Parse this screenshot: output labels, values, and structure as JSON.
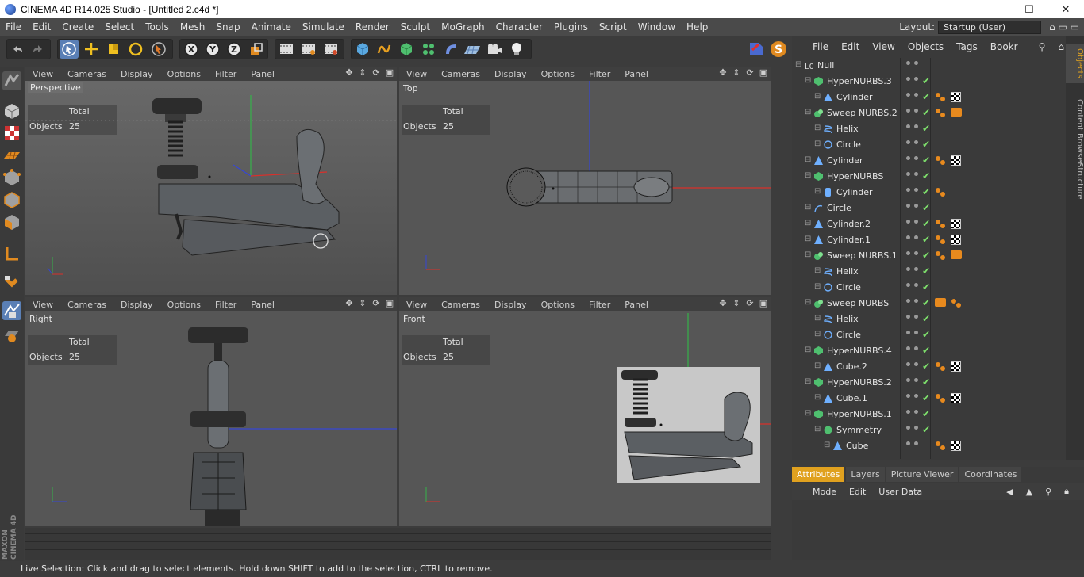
{
  "titlebar": {
    "title": "CINEMA 4D R14.025 Studio - [Untitled 2.c4d *]",
    "min": "—",
    "max": "☐",
    "close": "✕"
  },
  "menu": [
    "File",
    "Edit",
    "Create",
    "Select",
    "Tools",
    "Mesh",
    "Snap",
    "Animate",
    "Simulate",
    "Render",
    "Sculpt",
    "MoGraph",
    "Character",
    "Plugins",
    "Script",
    "Window",
    "Help"
  ],
  "layout": {
    "label": "Layout:",
    "value": "Startup (User)"
  },
  "viewport_menu": [
    "View",
    "Cameras",
    "Display",
    "Options",
    "Filter",
    "Panel"
  ],
  "viewports": [
    {
      "label": "Perspective",
      "hud_total": "Total",
      "hud_objects": "Objects",
      "hud_count": "25"
    },
    {
      "label": "Top",
      "hud_total": "Total",
      "hud_objects": "Objects",
      "hud_count": "25"
    },
    {
      "label": "Right",
      "hud_total": "Total",
      "hud_objects": "Objects",
      "hud_count": "25"
    },
    {
      "label": "Front",
      "hud_total": "Total",
      "hud_objects": "Objects",
      "hud_count": "25"
    }
  ],
  "objects_menu": [
    "File",
    "Edit",
    "View",
    "Objects",
    "Tags",
    "Bookr"
  ],
  "objects": [
    {
      "name": "Null",
      "indent": 0,
      "icon": "null",
      "check": false,
      "tags": []
    },
    {
      "name": "HyperNURBS.3",
      "indent": 1,
      "icon": "nurbs",
      "check": true,
      "tags": []
    },
    {
      "name": "Cylinder",
      "indent": 2,
      "icon": "prim",
      "check": true,
      "tags": [
        "orange",
        "checker"
      ]
    },
    {
      "name": "Sweep NURBS.2",
      "indent": 1,
      "icon": "sweep",
      "check": true,
      "tags": [
        "orange",
        "cam"
      ]
    },
    {
      "name": "Helix",
      "indent": 2,
      "icon": "helix",
      "check": true,
      "tags": []
    },
    {
      "name": "Circle",
      "indent": 2,
      "icon": "circle",
      "check": true,
      "tags": []
    },
    {
      "name": "Cylinder",
      "indent": 1,
      "icon": "prim",
      "check": true,
      "tags": [
        "orange",
        "checker"
      ]
    },
    {
      "name": "HyperNURBS",
      "indent": 1,
      "icon": "nurbs",
      "check": true,
      "tags": []
    },
    {
      "name": "Cylinder",
      "indent": 2,
      "icon": "cyl",
      "check": true,
      "tags": [
        "orange"
      ]
    },
    {
      "name": "Circle",
      "indent": 1,
      "icon": "spline",
      "check": true,
      "tags": []
    },
    {
      "name": "Cylinder.2",
      "indent": 1,
      "icon": "prim",
      "check": true,
      "tags": [
        "orange",
        "checker"
      ]
    },
    {
      "name": "Cylinder.1",
      "indent": 1,
      "icon": "prim",
      "check": true,
      "tags": [
        "orange",
        "checker"
      ]
    },
    {
      "name": "Sweep NURBS.1",
      "indent": 1,
      "icon": "sweep",
      "check": true,
      "tags": [
        "orange",
        "cam"
      ]
    },
    {
      "name": "Helix",
      "indent": 2,
      "icon": "helix",
      "check": true,
      "tags": []
    },
    {
      "name": "Circle",
      "indent": 2,
      "icon": "circle",
      "check": true,
      "tags": []
    },
    {
      "name": "Sweep NURBS",
      "indent": 1,
      "icon": "sweep",
      "check": true,
      "tags": [
        "cam",
        "orange"
      ]
    },
    {
      "name": "Helix",
      "indent": 2,
      "icon": "helix",
      "check": true,
      "tags": []
    },
    {
      "name": "Circle",
      "indent": 2,
      "icon": "circle",
      "check": true,
      "tags": []
    },
    {
      "name": "HyperNURBS.4",
      "indent": 1,
      "icon": "nurbs",
      "check": true,
      "tags": []
    },
    {
      "name": "Cube.2",
      "indent": 2,
      "icon": "prim",
      "check": true,
      "tags": [
        "orange",
        "checker"
      ]
    },
    {
      "name": "HyperNURBS.2",
      "indent": 1,
      "icon": "nurbs",
      "check": true,
      "tags": []
    },
    {
      "name": "Cube.1",
      "indent": 2,
      "icon": "prim",
      "check": true,
      "tags": [
        "orange",
        "checker"
      ]
    },
    {
      "name": "HyperNURBS.1",
      "indent": 1,
      "icon": "nurbs",
      "check": true,
      "tags": []
    },
    {
      "name": "Symmetry",
      "indent": 2,
      "icon": "sym",
      "check": true,
      "tags": []
    },
    {
      "name": "Cube",
      "indent": 3,
      "icon": "prim",
      "check": false,
      "tags": [
        "orange",
        "checker"
      ]
    }
  ],
  "side_tabs": [
    "Objects",
    "Content Browser",
    "Structure"
  ],
  "attr_tabs": [
    "Attributes",
    "Layers",
    "Picture Viewer",
    "Coordinates"
  ],
  "attr_menu": [
    "Mode",
    "Edit",
    "User Data"
  ],
  "status": "Live Selection: Click and drag to select elements. Hold down SHIFT to add to the selection, CTRL to remove.",
  "logo": {
    "line1": "MAXON",
    "line2": "CINEMA 4D"
  },
  "colors": {
    "accent": "#e0a11f",
    "axis_x": "#d9302b",
    "axis_y": "#36b24a",
    "axis_z": "#3646d6"
  }
}
